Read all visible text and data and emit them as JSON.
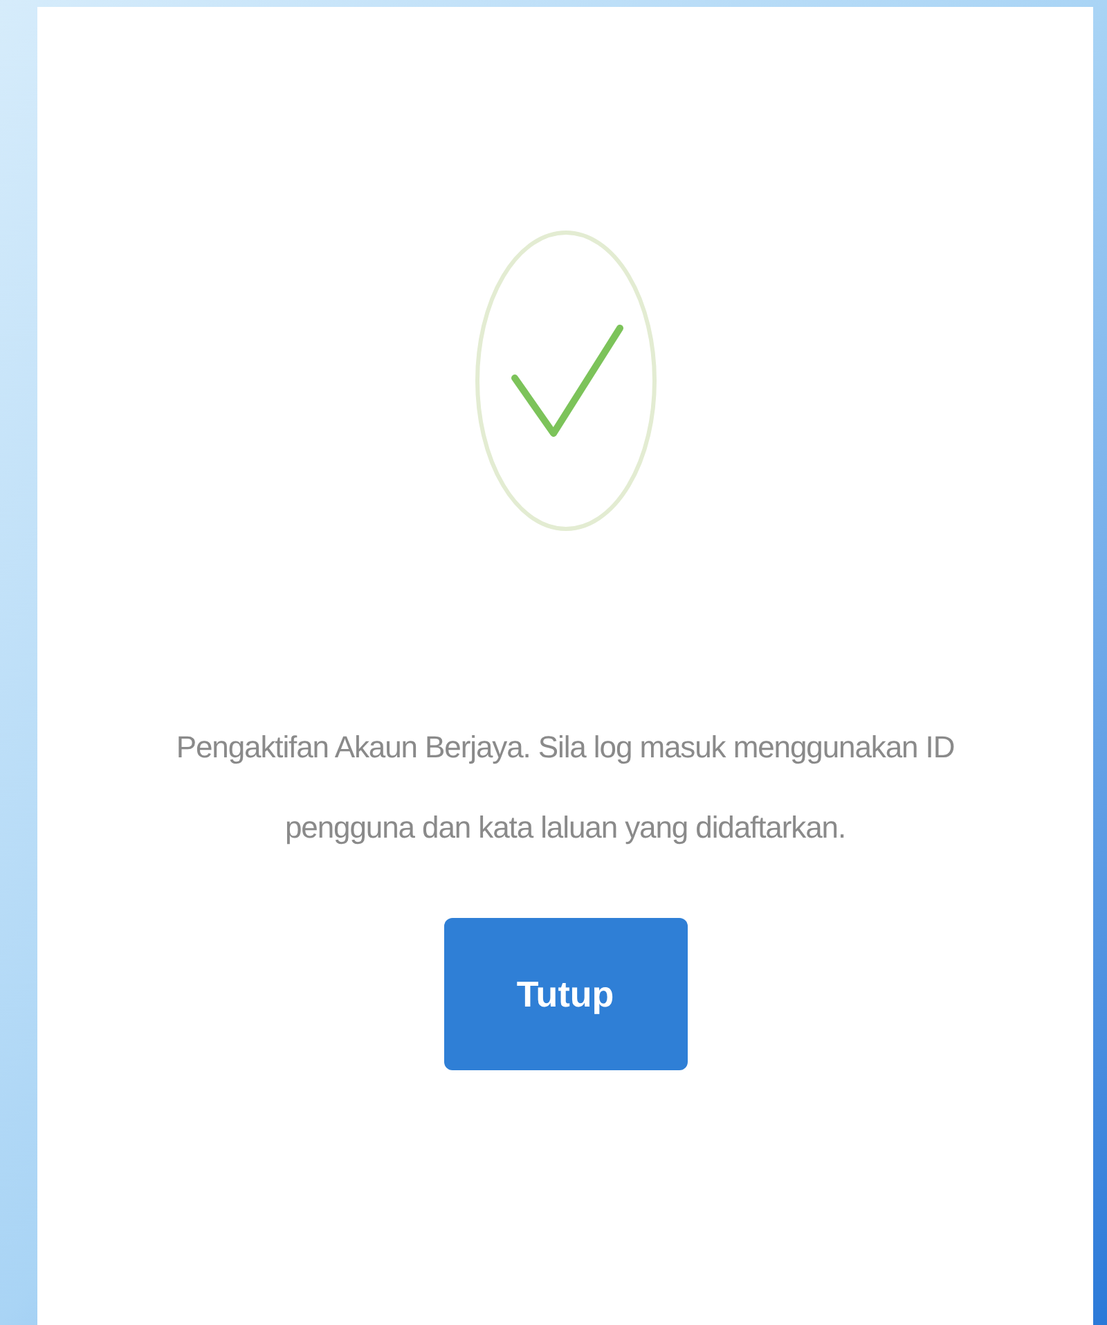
{
  "dialog": {
    "message": "Pengaktifan Akaun Berjaya. Sila log masuk menggunakan ID pengguna dan kata laluan yang didaftarkan.",
    "button": "Tutup"
  }
}
